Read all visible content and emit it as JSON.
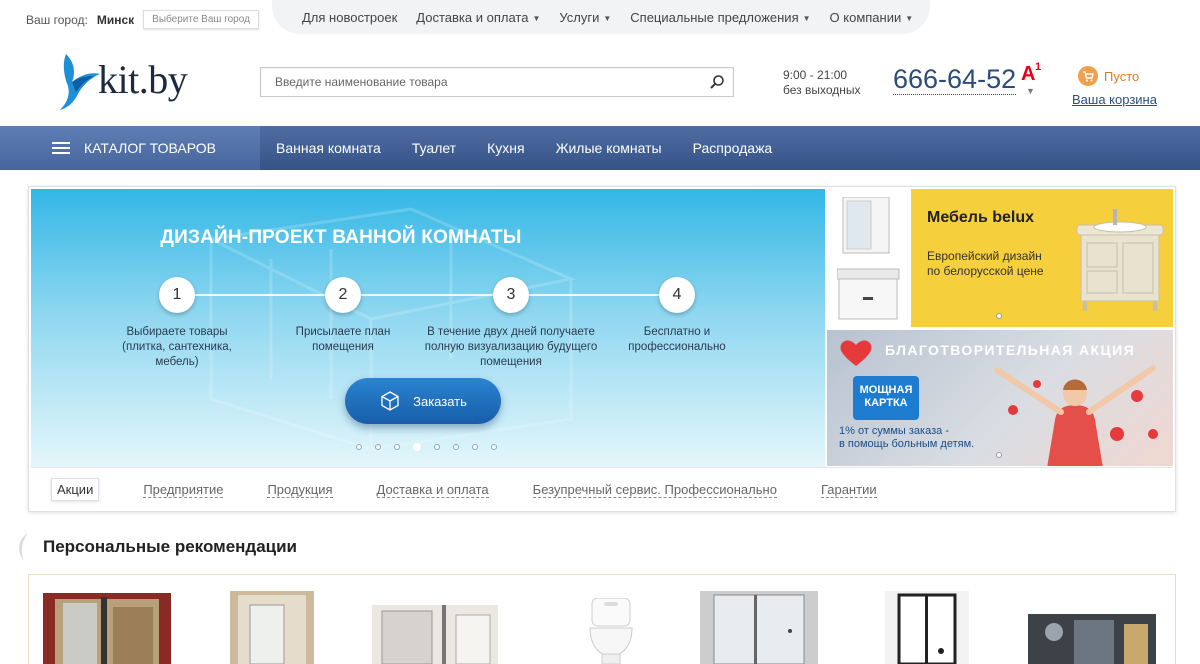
{
  "topbar": {
    "city_label": "Ваш город:",
    "city_name": "Минск",
    "city_choose": "Выберите Ваш город",
    "nav": [
      {
        "label": "Для новостроек",
        "dropdown": false
      },
      {
        "label": "Доставка и оплата",
        "dropdown": true
      },
      {
        "label": "Услуги",
        "dropdown": true
      },
      {
        "label": "Специальные предложения",
        "dropdown": true
      },
      {
        "label": "О компании",
        "dropdown": true
      }
    ]
  },
  "header": {
    "logo_text": "kit.by",
    "search_placeholder": "Введите наименование товара",
    "hours_line1": "9:00 - 21:00",
    "hours_line2": "без выходных",
    "phone": "666-64-52",
    "operator": "A1",
    "cart_status": "Пусто",
    "cart_link": "Ваша корзина"
  },
  "mainnav": {
    "catalog": "КАТАЛОГ ТОВАРОВ",
    "links": [
      "Ванная комната",
      "Туалет",
      "Кухня",
      "Жилые комнаты",
      "Распродажа"
    ]
  },
  "hero": {
    "title": "ДИЗАЙН-ПРОЕКТ ВАННОЙ КОМНАТЫ",
    "steps": [
      {
        "num": "1",
        "text": "Выбираете товары (плитка, сантехника, мебель)"
      },
      {
        "num": "2",
        "text": "Присылаете план помещения"
      },
      {
        "num": "3",
        "text": "В течение двух дней получаете полную визуализацию будущего помещения"
      },
      {
        "num": "4",
        "text": "Бесплатно и профессионально"
      }
    ],
    "button": "Заказать",
    "slide_count": 8,
    "active_slide": 4
  },
  "side_banners": {
    "belux_title": "Мебель belux",
    "belux_line1": "Европейский дизайн",
    "belux_line2": "по белорусской цене",
    "charity_title": "БЛАГОТВОРИТЕЛЬНАЯ АКЦИЯ",
    "charity_card_line1": "МОЩНАЯ",
    "charity_card_line2": "КАРТКА",
    "charity_line1": "1% от суммы заказа -",
    "charity_line2": "в помощь больным детям."
  },
  "tabs": [
    "Акции",
    "Предприятие",
    "Продукция",
    "Доставка и оплата",
    "Безупречный сервис. Профессионально",
    "Гарантии"
  ],
  "recommendations": {
    "title": "Персональные рекомендации"
  },
  "colors": {
    "nav_blue": "#3d5b90",
    "phone_blue": "#2c4a7a",
    "cart_orange": "#e07a1f",
    "hero_blue": "#33b7e6",
    "banner_yellow": "#f6cf3d"
  }
}
